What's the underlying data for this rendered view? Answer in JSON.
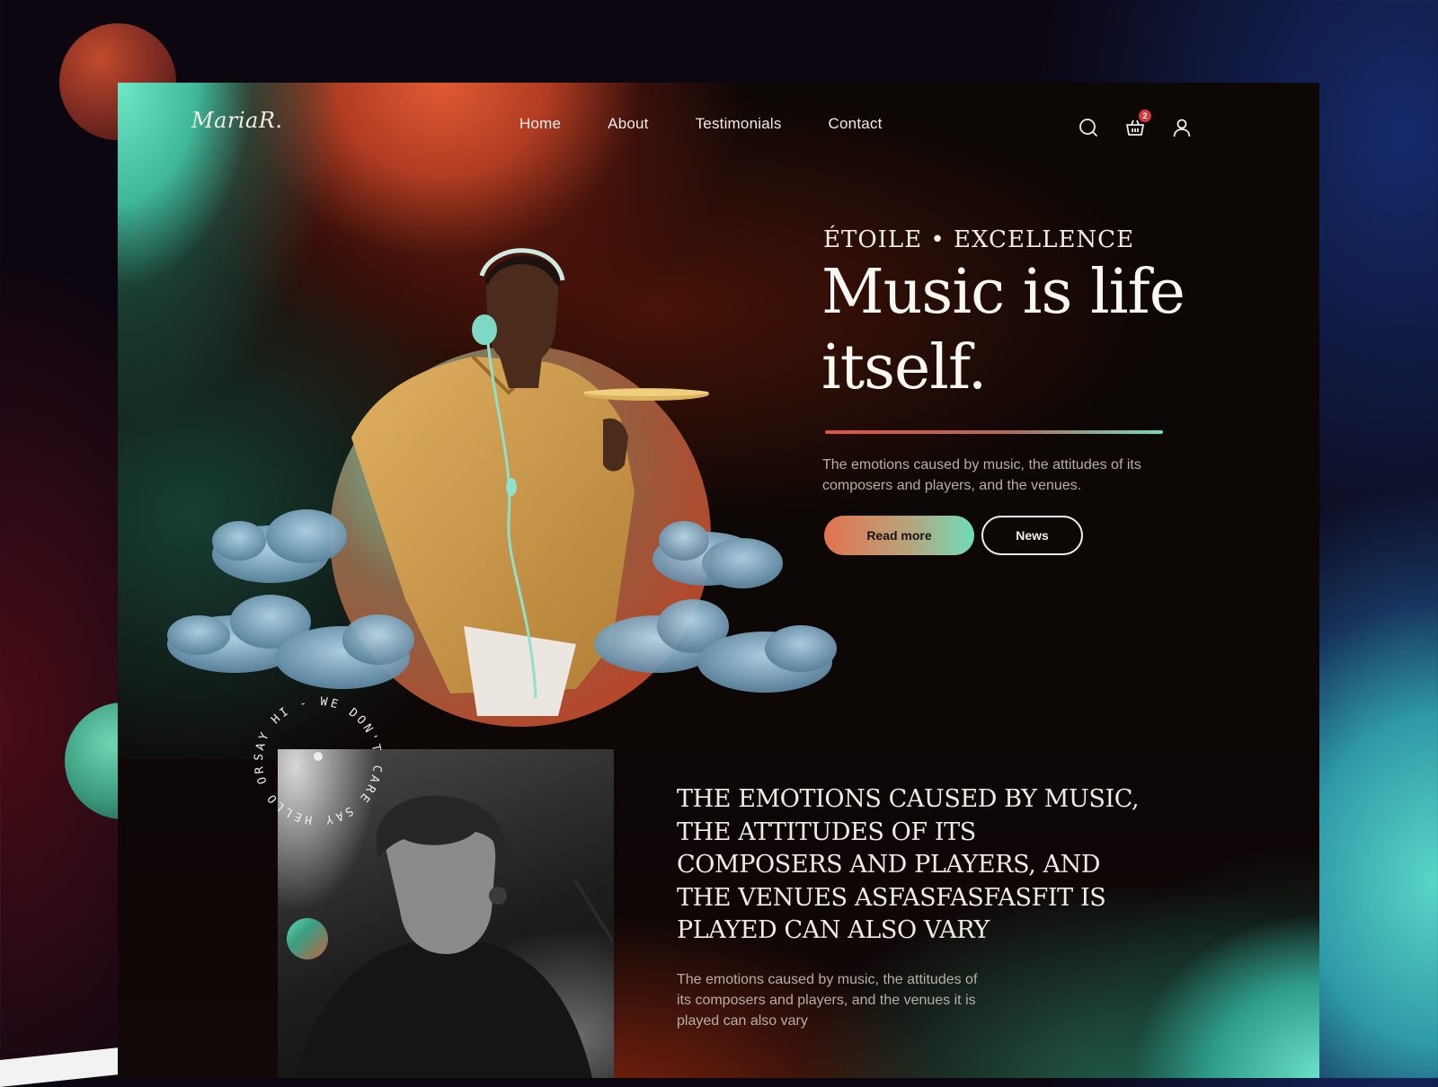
{
  "brand": {
    "logo": "MariaR."
  },
  "nav": {
    "items": [
      "Home",
      "About",
      "Testimonials",
      "Contact"
    ]
  },
  "header_icons": {
    "search": "search-icon",
    "cart": "basket-icon",
    "cart_count": "2",
    "account": "user-icon"
  },
  "hero": {
    "eyebrow": "ÉTOILE • EXCELLENCE",
    "headline": "Music is life itself.",
    "subtext": "The emotions caused by music, the attitudes of its composers and players, and the venues.",
    "primary_button": "Read more",
    "secondary_button": "News",
    "image": "man-with-headphones-and-cymbal-in-clouds"
  },
  "about": {
    "circular_badge_text": "SAY HI - WE DON'T CARE SAY HELLO OR ",
    "photo": "singer-with-microphone-black-and-white",
    "title": "THE EMOTIONS CAUSED BY MUSIC, THE ATTITUDES OF ITS COMPOSERS AND PLAYERS, AND THE VENUES ASFASFASFASFIT IS PLAYED CAN ALSO VARY",
    "subtext": "The emotions caused by music, the attitudes of its composers and players, and the venues it is played can also vary"
  },
  "colors": {
    "accent_orange": "#e2734f",
    "accent_mint": "#6fdcb8",
    "badge_red": "#d43c3c",
    "text_light": "#f1ece8",
    "text_muted": "#b9aea8"
  }
}
